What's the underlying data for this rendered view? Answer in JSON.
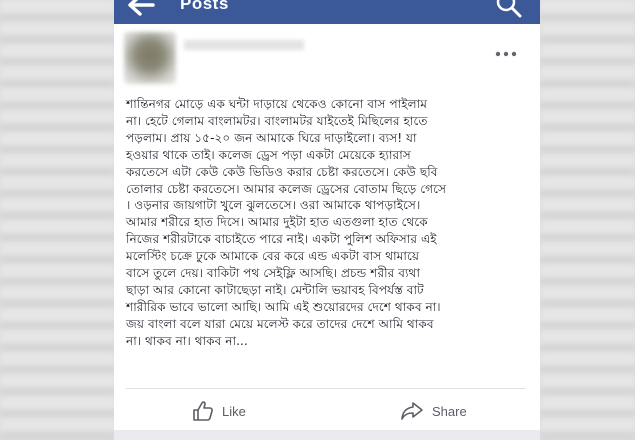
{
  "topbar": {
    "title": "Posts",
    "icons": [
      "back-arrow-icon",
      "search-icon"
    ],
    "color": "#3b5998"
  },
  "post": {
    "icons": [
      "avatar",
      "more-icon"
    ],
    "lines": [
      "শান্তিনগর মোড়ে এক ঘন্টা দাড়ায়ে থেকেও কোনো বাস পাইলাম",
      "না। হেটে গেলাম বাংলামটর। বাংলামটর যাইতেই মিছিলের হাতে",
      "পড়লাম। প্রায় ১৫-২০ জন আমাকে ঘিরে দাড়াইলো। ব্যস! যা",
      "হওয়ার থাকে তাই। কলেজ ড্রেস পড়া একটা মেয়েকে হ্যারাস",
      "করতেসে এটা কেউ কেউ ভিডিও করার চেষ্টা করতেসে। কেউ ছবি",
      "তোলার চেষ্টা করতেসে। আমার কলেজ ড্রেসের বোতাম ছিড়ে গেসে",
      "। ওড়নার জায়গাটা খুলে ঝুলতেসে। ওরা আমাকে থাপড়াইসে।",
      "আমার শরীরে হাত দিসে। আমার দুইটা হাত এতগুলা হাত থেকে",
      "নিজের শরীরটাকে বাচাইতে পারে নাই। একটা পুলিশ অফিসার এই",
      "মলেস্টিং চক্রে ঢুকে আমাকে বের করে এন্ড একটা বাস থামায়ে",
      "বাসে তুলে দেয়। বাকিটা পথ সেইফ্লি আসছি। প্রচন্ড শরীর ব্যথা",
      "ছাড়া আর কোনো কাটাছেড়া নাই। মেন্টালি ভয়াবহ বিপর্যস্ত বাট",
      "শারীরিক ভাবে ভালো আছি। আমি এই শুয়োরদের দেশে থাকব না।",
      "জয় বাংলা বলে যারা মেয়ে মলেস্ট করে তাদের দেশে আমি থাকব",
      "না। থাকব না। থাকব না..."
    ]
  },
  "actions": {
    "like_label": "Like",
    "share_label": "Share",
    "icons": [
      "like-thumb-icon",
      "share-arrow-icon"
    ]
  }
}
